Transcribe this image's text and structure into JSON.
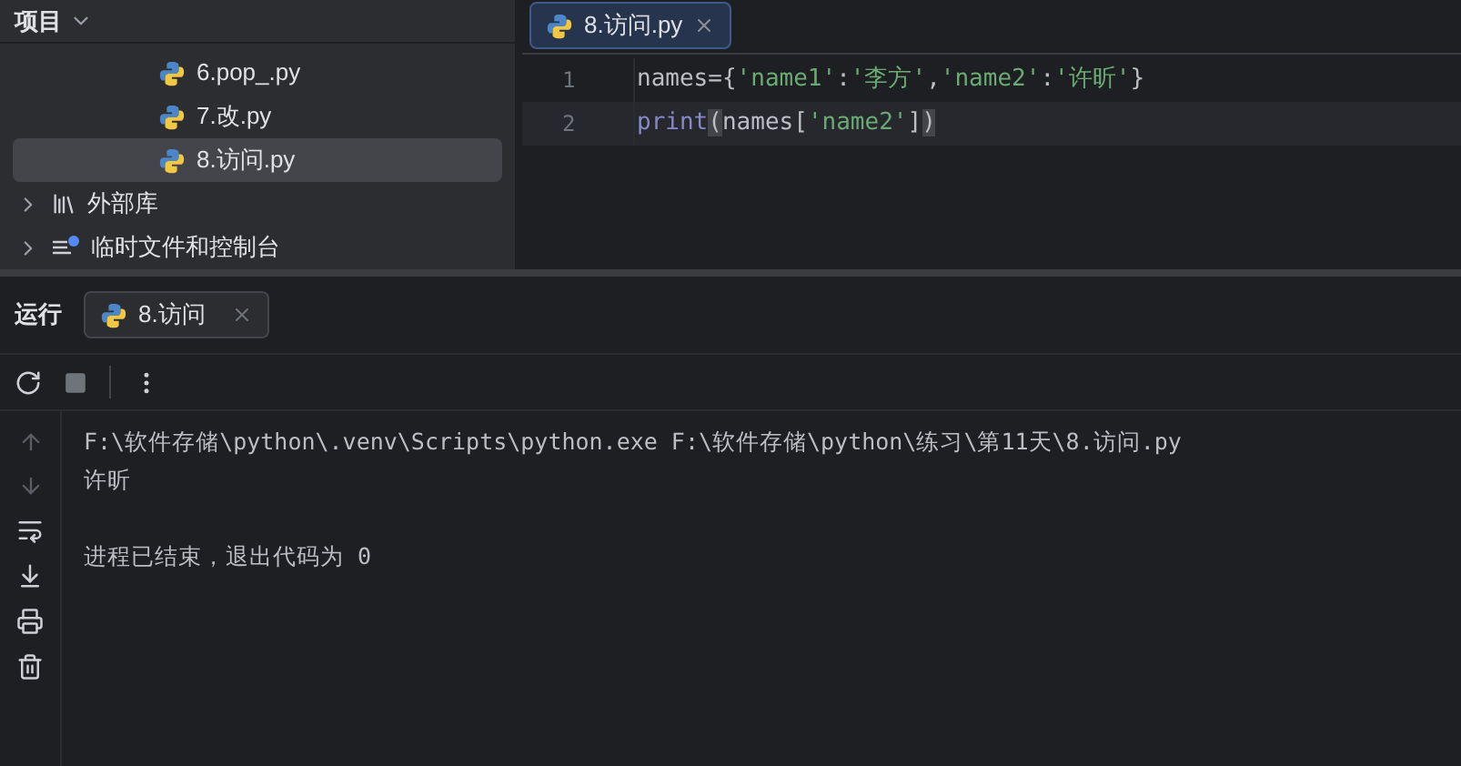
{
  "project_panel": {
    "title": "项目",
    "tree": [
      {
        "kind": "file",
        "label": "6.pop_.py",
        "selected": false
      },
      {
        "kind": "file",
        "label": "7.改.py",
        "selected": false
      },
      {
        "kind": "file",
        "label": "8.访问.py",
        "selected": true
      },
      {
        "kind": "library",
        "label": "外部库",
        "expanded": false
      },
      {
        "kind": "scratch",
        "label": "临时文件和控制台",
        "expanded": false
      }
    ]
  },
  "editor": {
    "tabs": [
      {
        "label": "8.访问.py",
        "selected": true
      }
    ],
    "lines": [
      {
        "number": "1",
        "current": false,
        "tokens": [
          {
            "kind": "plain",
            "text": "names={"
          },
          {
            "kind": "string",
            "text": "'name1'"
          },
          {
            "kind": "plain",
            "text": ":"
          },
          {
            "kind": "string",
            "text": "'李方'"
          },
          {
            "kind": "plain",
            "text": ","
          },
          {
            "kind": "string",
            "text": "'name2'"
          },
          {
            "kind": "plain",
            "text": ":"
          },
          {
            "kind": "string",
            "text": "'许昕'"
          },
          {
            "kind": "plain",
            "text": "}"
          }
        ]
      },
      {
        "number": "2",
        "current": true,
        "tokens": [
          {
            "kind": "builtin",
            "text": "print"
          },
          {
            "kind": "brace",
            "text": "("
          },
          {
            "kind": "plain",
            "text": "names["
          },
          {
            "kind": "string",
            "text": "'name2'"
          },
          {
            "kind": "plain",
            "text": "]"
          },
          {
            "kind": "brace",
            "text": ")"
          }
        ]
      }
    ]
  },
  "run_panel": {
    "title": "运行",
    "tabs": [
      {
        "label": "8.访问",
        "selected": true
      }
    ],
    "output_blocks": [
      {
        "lines": [
          "F:\\软件存储\\python\\.venv\\Scripts\\python.exe F:\\软件存储\\python\\练习\\第11天\\8.访问.py",
          "许昕"
        ]
      },
      {
        "lines": [
          "进程已结束，退出代码为 0"
        ]
      }
    ]
  }
}
